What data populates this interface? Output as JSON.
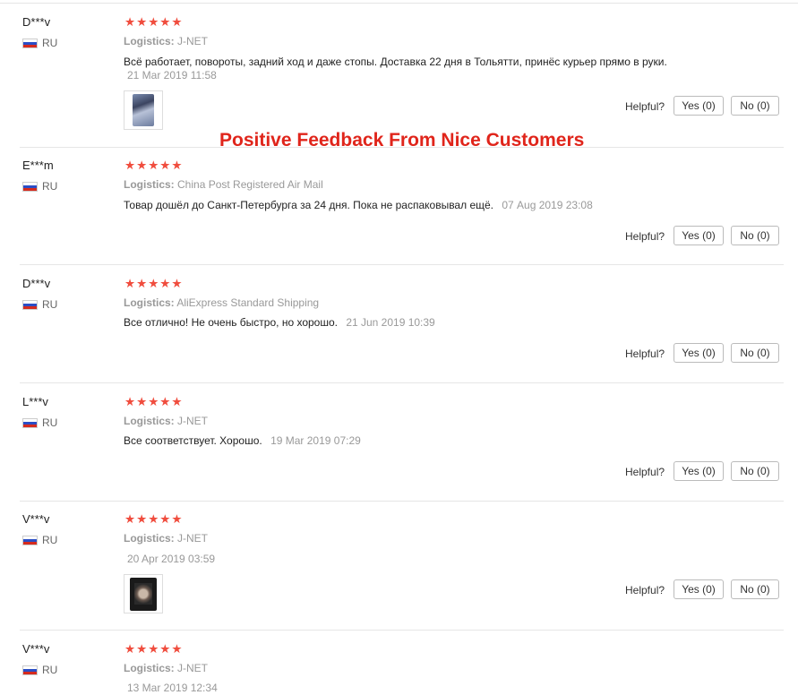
{
  "overlay_title": "Positive Feedback From Nice Customers",
  "stars_glyph": "★★★★★",
  "helpful_label": "Helpful?",
  "reviews": [
    {
      "user": "D***v",
      "country": "RU",
      "logistics_label": "Logistics:",
      "logistics": "J-NET",
      "text": "Всё работает, повороты, задний ход и даже стопы. Доставка 22 дня в Тольятти, принёс курьер прямо в руки.",
      "date": "21 Mar 2019 11:58",
      "rating": 5,
      "yes": "Yes (0)",
      "no": "No (0)",
      "has_photo": true
    },
    {
      "user": "E***m",
      "country": "RU",
      "logistics_label": "Logistics:",
      "logistics": "China Post Registered Air Mail",
      "text": "Товар дошёл до Санкт-Петербурга за 24 дня. Пока не распаковывал ещё.",
      "date": "07 Aug 2019 23:08",
      "rating": 5,
      "yes": "Yes (0)",
      "no": "No (0)",
      "has_photo": false
    },
    {
      "user": "D***v",
      "country": "RU",
      "logistics_label": "Logistics:",
      "logistics": "AliExpress Standard Shipping",
      "text": "Все отлично! Не очень быстро, но хорошо.",
      "date": "21 Jun 2019 10:39",
      "rating": 5,
      "yes": "Yes (0)",
      "no": "No (0)",
      "has_photo": false
    },
    {
      "user": "L***v",
      "country": "RU",
      "logistics_label": "Logistics:",
      "logistics": "J-NET",
      "text": "Все соответствует. Хорошо.",
      "date": "19 Mar 2019 07:29",
      "rating": 5,
      "yes": "Yes (0)",
      "no": "No (0)",
      "has_photo": false
    },
    {
      "user": "V***v",
      "country": "RU",
      "logistics_label": "Logistics:",
      "logistics": "J-NET",
      "text": "",
      "date": "20 Apr 2019 03:59",
      "rating": 5,
      "yes": "Yes (0)",
      "no": "No (0)",
      "has_photo": true
    },
    {
      "user": "V***v",
      "country": "RU",
      "logistics_label": "Logistics:",
      "logistics": "J-NET",
      "text": "",
      "date": "13 Mar 2019 12:34",
      "rating": 5,
      "yes": "",
      "no": "",
      "has_photo": false
    }
  ]
}
